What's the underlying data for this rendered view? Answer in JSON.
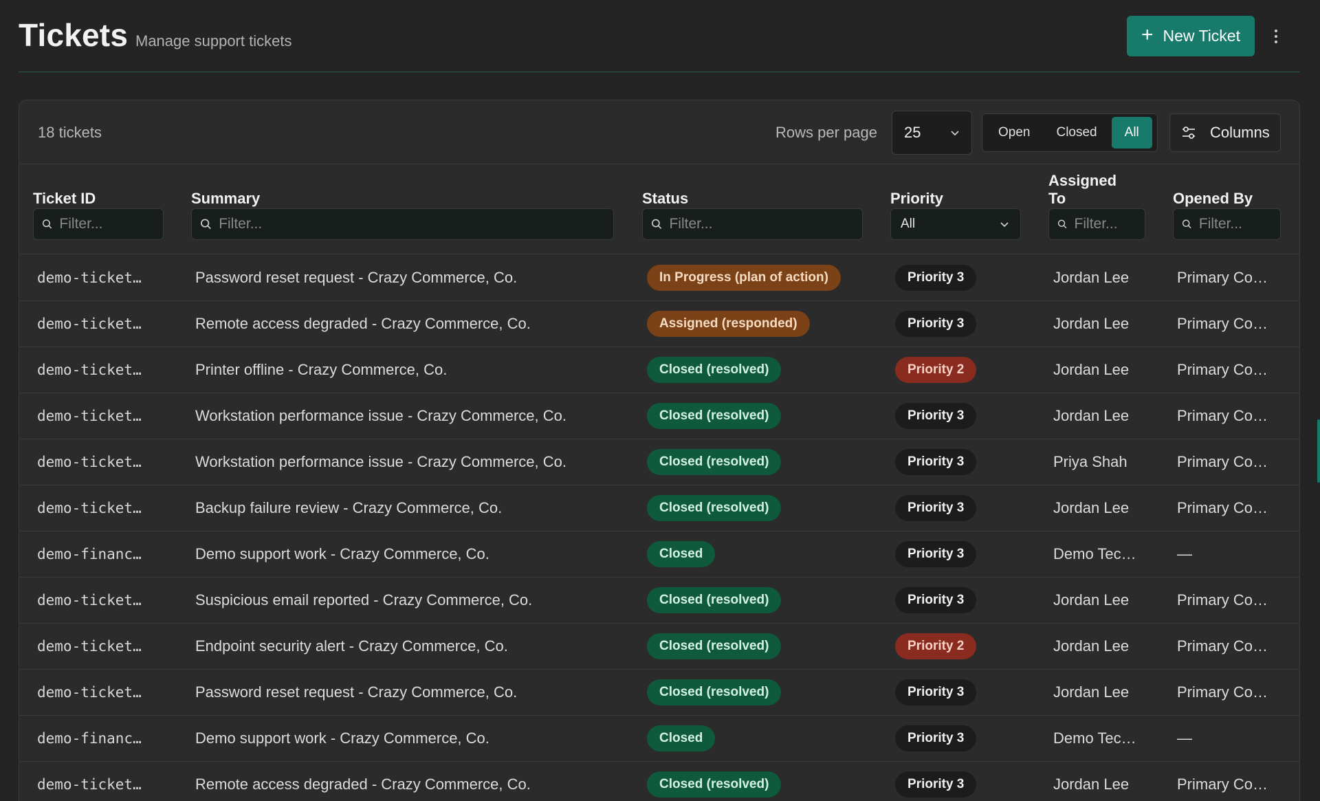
{
  "header": {
    "title": "Tickets",
    "subtitle": "Manage support tickets",
    "new_ticket_label": "New Ticket",
    "new_ticket_icon": "plus-icon",
    "menu_icon": "more-vertical-icon"
  },
  "toolbar": {
    "ticket_count": "18 tickets",
    "rows_per_page_label": "Rows per page",
    "rows_per_page_value": "25",
    "status_filter": [
      "Open",
      "Closed",
      "All"
    ],
    "status_filter_selected": "All",
    "columns_label": "Columns",
    "columns_icon": "sliders-icon"
  },
  "columns": {
    "ticket_id": "Ticket ID",
    "summary": "Summary",
    "status": "Status",
    "priority": "Priority",
    "assigned_to_line1": "Assigned",
    "assigned_to_line2": "To",
    "opened_by": "Opened By"
  },
  "filters": {
    "placeholder": "Filter...",
    "priority_value": "All"
  },
  "colors": {
    "accent": "#187a6a",
    "status_in_progress": "#7a4216",
    "status_closed": "#0f5a3c",
    "priority_2": "#8a2b1f",
    "priority_3": "#1c1c1c"
  },
  "rows": [
    {
      "id": "demo-ticket…",
      "summary": "Password reset request - Crazy Commerce, Co.",
      "status": "In Progress (plan of action)",
      "status_kind": "orange",
      "priority": "Priority 3",
      "priority_kind": "gray",
      "assigned": "Jordan Lee",
      "opened_by": "Primary Co…"
    },
    {
      "id": "demo-ticket…",
      "summary": "Remote access degraded - Crazy Commerce, Co.",
      "status": "Assigned (responded)",
      "status_kind": "orange",
      "priority": "Priority 3",
      "priority_kind": "gray",
      "assigned": "Jordan Lee",
      "opened_by": "Primary Co…"
    },
    {
      "id": "demo-ticket…",
      "summary": "Printer offline - Crazy Commerce, Co.",
      "status": "Closed (resolved)",
      "status_kind": "green",
      "priority": "Priority 2",
      "priority_kind": "red",
      "assigned": "Jordan Lee",
      "opened_by": "Primary Co…"
    },
    {
      "id": "demo-ticket…",
      "summary": "Workstation performance issue - Crazy Commerce, Co.",
      "status": "Closed (resolved)",
      "status_kind": "green",
      "priority": "Priority 3",
      "priority_kind": "gray",
      "assigned": "Jordan Lee",
      "opened_by": "Primary Co…"
    },
    {
      "id": "demo-ticket…",
      "summary": "Workstation performance issue - Crazy Commerce, Co.",
      "status": "Closed (resolved)",
      "status_kind": "green",
      "priority": "Priority 3",
      "priority_kind": "gray",
      "assigned": "Priya Shah",
      "opened_by": "Primary Co…"
    },
    {
      "id": "demo-ticket…",
      "summary": "Backup failure review - Crazy Commerce, Co.",
      "status": "Closed (resolved)",
      "status_kind": "green",
      "priority": "Priority 3",
      "priority_kind": "gray",
      "assigned": "Jordan Lee",
      "opened_by": "Primary Co…"
    },
    {
      "id": "demo-financ…",
      "summary": "Demo support work - Crazy Commerce, Co.",
      "status": "Closed",
      "status_kind": "green",
      "priority": "Priority 3",
      "priority_kind": "gray",
      "assigned": "Demo Tec…",
      "opened_by": "—"
    },
    {
      "id": "demo-ticket…",
      "summary": "Suspicious email reported - Crazy Commerce, Co.",
      "status": "Closed (resolved)",
      "status_kind": "green",
      "priority": "Priority 3",
      "priority_kind": "gray",
      "assigned": "Jordan Lee",
      "opened_by": "Primary Co…"
    },
    {
      "id": "demo-ticket…",
      "summary": "Endpoint security alert - Crazy Commerce, Co.",
      "status": "Closed (resolved)",
      "status_kind": "green",
      "priority": "Priority 2",
      "priority_kind": "red",
      "assigned": "Jordan Lee",
      "opened_by": "Primary Co…"
    },
    {
      "id": "demo-ticket…",
      "summary": "Password reset request - Crazy Commerce, Co.",
      "status": "Closed (resolved)",
      "status_kind": "green",
      "priority": "Priority 3",
      "priority_kind": "gray",
      "assigned": "Jordan Lee",
      "opened_by": "Primary Co…"
    },
    {
      "id": "demo-financ…",
      "summary": "Demo support work - Crazy Commerce, Co.",
      "status": "Closed",
      "status_kind": "green",
      "priority": "Priority 3",
      "priority_kind": "gray",
      "assigned": "Demo Tec…",
      "opened_by": "—"
    },
    {
      "id": "demo-ticket…",
      "summary": "Remote access degraded - Crazy Commerce, Co.",
      "status": "Closed (resolved)",
      "status_kind": "green",
      "priority": "Priority 3",
      "priority_kind": "gray",
      "assigned": "Jordan Lee",
      "opened_by": "Primary Co…"
    }
  ]
}
